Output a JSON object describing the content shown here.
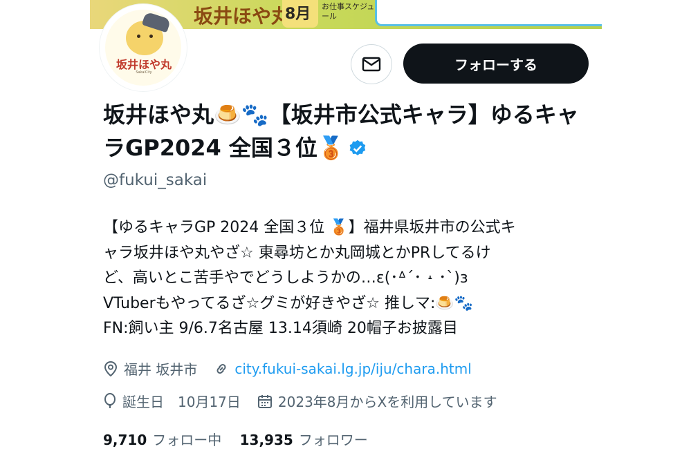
{
  "banner": {
    "text": "坂井ほや丸",
    "month": "8月",
    "subtitle": "お仕事スケジュール"
  },
  "avatar": {
    "logo": "坂井ほや丸",
    "caption": "SakaiCity"
  },
  "actions": {
    "follow_label": "フォローする"
  },
  "profile": {
    "name": "坂井ほや丸🍮🐾【坂井市公式キャラ】ゆるキャラGP2024 全国３位🥉",
    "handle": "@fukui_sakai",
    "bio": [
      "【ゆるキャラGP 2024 全国３位 🥉】福井県坂井市の公式キ",
      "ャラ坂井ほや丸やざ☆ 東尋坊とか丸岡城とかPRしてるけ",
      "ど、高いとこ苦手やでどうしようかの…ε(･ᐞ´･ ˔ ･`)з",
      "VTuberもやってるざ☆グミが好きやざ☆ 推しマ:🍮🐾",
      "FN:飼い主 9/6.7名古屋 13.14須崎 20帽子お披露目"
    ],
    "location": "福井 坂井市",
    "website": "city.fukui-sakai.lg.jp/iju/chara.html",
    "birthday": "誕生日　10月17日",
    "joined": "2023年8月からXを利用しています"
  },
  "stats": {
    "following_count": "9,710",
    "following_label": "フォロー中",
    "followers_count": "13,935",
    "followers_label": "フォロワー"
  },
  "colors": {
    "text": "#0f1419",
    "secondary": "#536471",
    "link": "#1d9bf0",
    "follow_bg": "#0f1419",
    "verified": "#1d9bf0"
  }
}
